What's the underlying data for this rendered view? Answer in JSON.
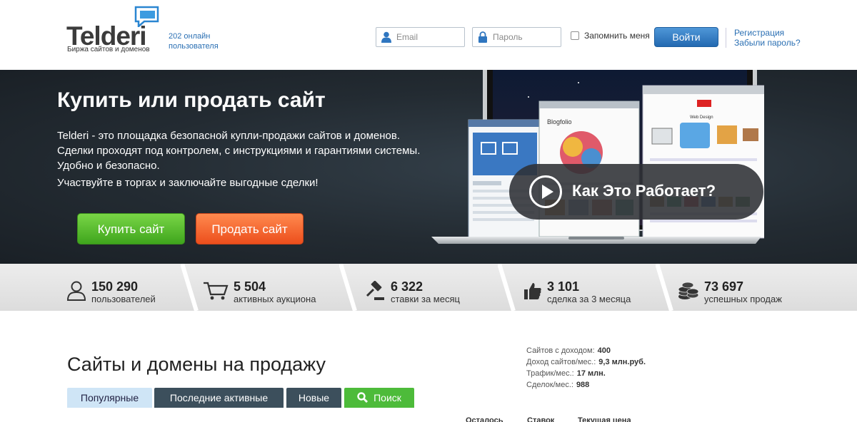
{
  "header": {
    "logo_text": "Telderi",
    "logo_tagline": "Биржа сайтов и доменов",
    "online_count": "202 онлайн",
    "online_label": "пользователя",
    "email_placeholder": "Email",
    "password_placeholder": "Пароль",
    "remember_label": "Запомнить меня",
    "login_label": "Войти",
    "register_link": "Регистрация",
    "forgot_link": "Забыли пароль?"
  },
  "hero": {
    "title": "Купить или продать сайт",
    "description": "Telderi - это площадка безопасной купли-продажи сайтов и доменов. Сделки проходят под контролем, с инструкциями и гарантиями системы. Удобно и безопасно.",
    "cta_text": "Участвуйте в торгах и заключайте выгодные сделки!",
    "buy_label": "Купить сайт",
    "sell_label": "Продать сайт",
    "video_label": "Как Это Работает?",
    "screen_blog_title": "Blogfolio",
    "screen_webdesign_title": "Web Design"
  },
  "stats": [
    {
      "value": "150 290",
      "label": "пользователей",
      "icon": "user-icon"
    },
    {
      "value": "5 504",
      "label": "активных аукциона",
      "icon": "cart-icon"
    },
    {
      "value": "6 322",
      "label": "ставки за месяц",
      "icon": "gavel-icon"
    },
    {
      "value": "3 101",
      "label": "сделка за 3 месяца",
      "icon": "thumbs-up-icon"
    },
    {
      "value": "73 697",
      "label": "успешных продаж",
      "icon": "coins-icon"
    }
  ],
  "main": {
    "section_title": "Сайты и домены на продажу",
    "tabs": [
      {
        "label": "Популярные"
      },
      {
        "label": "Последние активные"
      },
      {
        "label": "Новые"
      },
      {
        "label": "Поиск"
      }
    ],
    "side_stats": [
      {
        "label": "Сайтов с доходом:",
        "value": "400"
      },
      {
        "label": "Доход сайтов/мес.:",
        "value": "9,3 млн.руб."
      },
      {
        "label": "Трафик/мес.:",
        "value": "17 млн."
      },
      {
        "label": "Сделок/мес.:",
        "value": "988"
      }
    ],
    "columns": [
      "Осталось",
      "Ставок",
      "Текущая цена"
    ]
  },
  "colors": {
    "brand_blue": "#2a6fb3",
    "buy_green": "#4fb52a",
    "sell_orange": "#f26a35",
    "hero_dark": "#232b32",
    "tab_dark": "#3c4f5c",
    "tab_light": "#cfe5f6",
    "search_green": "#4dbb3a"
  }
}
